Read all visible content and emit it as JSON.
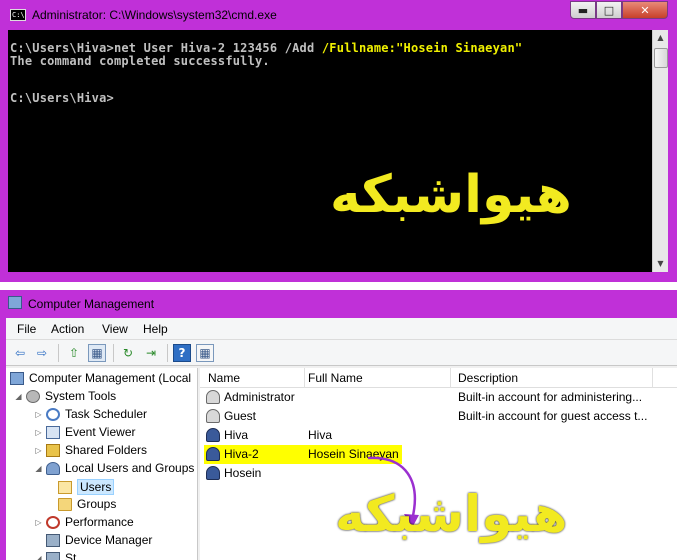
{
  "cmd": {
    "title": "Administrator: C:\\Windows\\system32\\cmd.exe",
    "app_icon_text": "C:\\",
    "caption_buttons": {
      "minimize": "▬",
      "maximize": "□",
      "close": "✕"
    },
    "lines": {
      "line1_prefix": "C:\\Users\\Hiva>net User Hiva-2 123456 /Add ",
      "line1_highlight": "/Fullname:\"Hosein Sinaeyan\"",
      "line2": "The command completed successfully.",
      "line3": "C:\\Users\\Hiva>"
    },
    "watermark": "هیواشبکه",
    "scroll": {
      "up": "▲",
      "down": "▼"
    }
  },
  "computer_management": {
    "title": "Computer Management",
    "menu": {
      "file": "File",
      "action": "Action",
      "view": "View",
      "help": "Help"
    },
    "toolbar": {
      "back": "⇦",
      "forward": "⇨",
      "up": "⇧",
      "show_hide": "▦",
      "refresh": "↻",
      "export": "⇥",
      "help": "?",
      "console": "▦"
    },
    "tree": {
      "root": "Computer Management (Local",
      "system_tools": "System Tools",
      "task_scheduler": "Task Scheduler",
      "event_viewer": "Event Viewer",
      "shared_folders": "Shared Folders",
      "local_users_groups": "Local Users and Groups",
      "users": "Users",
      "groups": "Groups",
      "performance": "Performance",
      "device_manager": "Device Manager",
      "storage_partial": "St"
    },
    "list": {
      "columns": {
        "name": "Name",
        "full_name": "Full Name",
        "description": "Description"
      },
      "rows": [
        {
          "name": "Administrator",
          "full_name": "",
          "description": "Built-in account for administering..."
        },
        {
          "name": "Guest",
          "full_name": "",
          "description": "Built-in account for guest access t..."
        },
        {
          "name": "Hiva",
          "full_name": "Hiva",
          "description": ""
        },
        {
          "name": "Hiva-2",
          "full_name": "Hosein Sinaeyan",
          "description": ""
        },
        {
          "name": "Hosein",
          "full_name": "",
          "description": ""
        }
      ]
    },
    "watermark": "هیواشبکه"
  },
  "colors": {
    "window_frame": "#c030d8",
    "console_bg": "#000000",
    "console_text": "#c0c0c0",
    "highlight_yellow": "#ffff00",
    "watermark": "#f2ea20",
    "arrow": "#9b30d0"
  }
}
